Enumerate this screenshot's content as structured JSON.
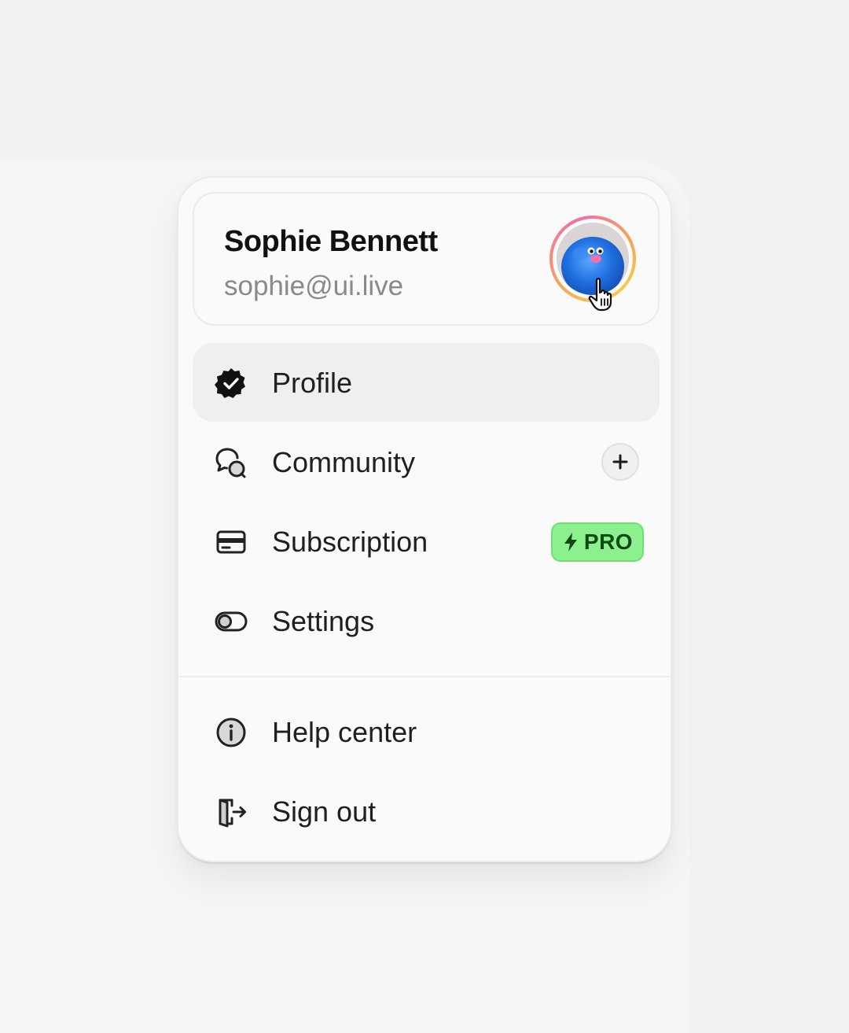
{
  "user": {
    "name": "Sophie Bennett",
    "email": "sophie@ui.live",
    "avatar_icon": "fluffy-blue-monster-avatar"
  },
  "menu": {
    "primary_items": [
      {
        "label": "Profile",
        "icon": "verified-badge-icon",
        "active": true
      },
      {
        "label": "Community",
        "icon": "chat-bubbles-icon",
        "action": "plus-icon"
      },
      {
        "label": "Subscription",
        "icon": "credit-card-icon",
        "badge": "PRO"
      },
      {
        "label": "Settings",
        "icon": "toggle-icon"
      }
    ],
    "secondary_items": [
      {
        "label": "Help center",
        "icon": "info-icon"
      },
      {
        "label": "Sign out",
        "icon": "sign-out-icon"
      }
    ]
  },
  "colors": {
    "pro_badge_bg": "#8cf08f",
    "pro_badge_text": "#0d4a12",
    "active_item_bg": "#efefef",
    "page_bg": "#f2f2f2",
    "card_bg": "#fafafa"
  }
}
